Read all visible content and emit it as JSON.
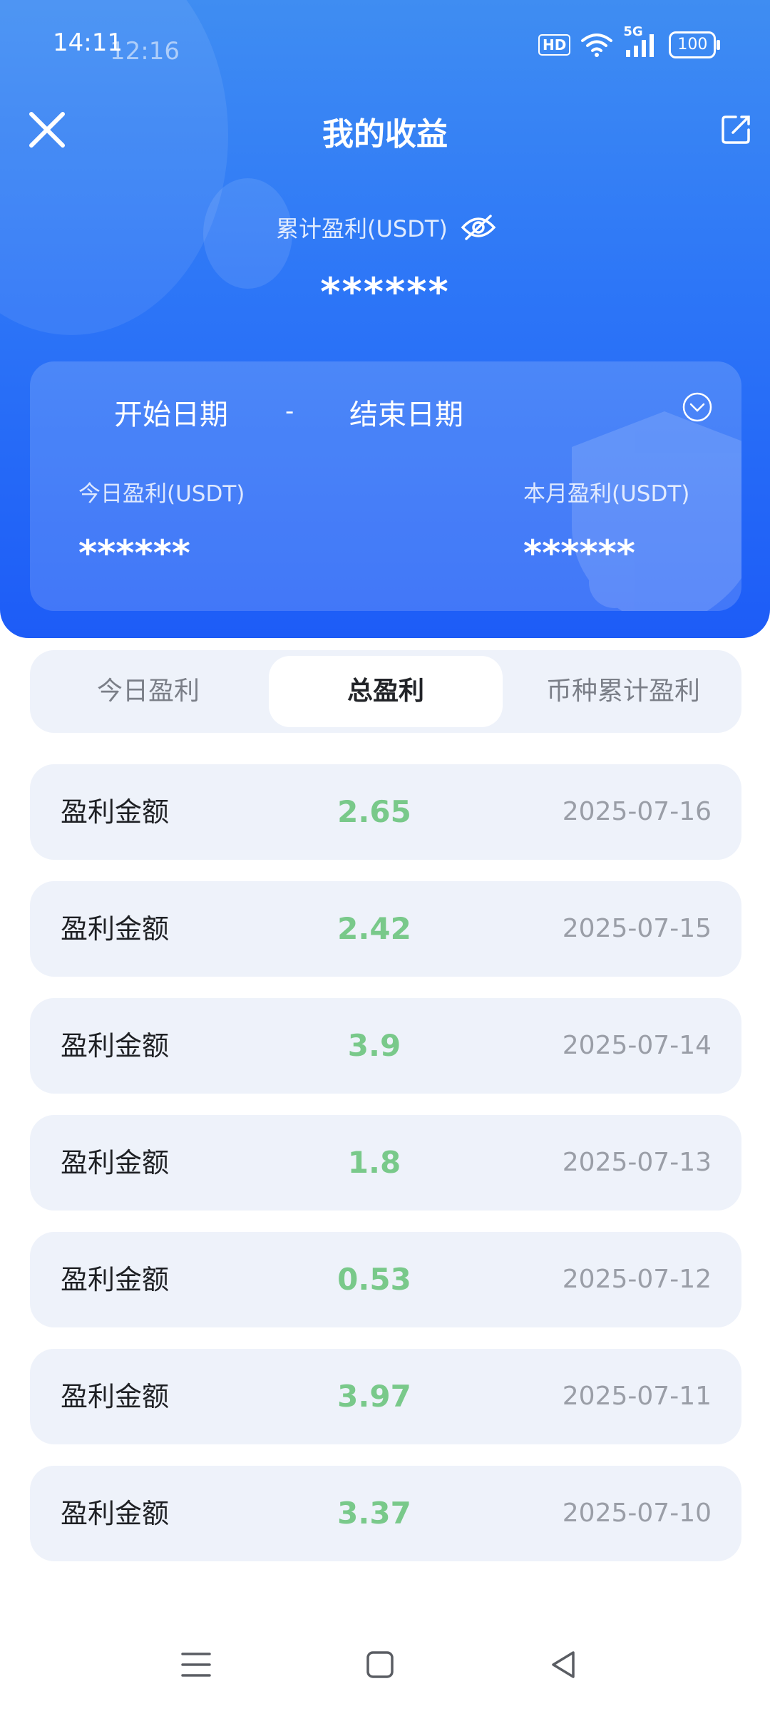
{
  "status_bar": {
    "time_primary": "14:11",
    "time_overlay": "12:16",
    "hd_badge": "HD",
    "network": "5G",
    "battery": "100"
  },
  "header": {
    "title": "我的收益",
    "close_icon": "close-x-icon",
    "share_icon": "share-export-icon",
    "cumulative_label": "累计盈利(USDT)",
    "cumulative_value": "******",
    "eye_icon": "eye-hidden-icon",
    "background_gradient": [
      "#3f8df2",
      "#1d5cf7"
    ]
  },
  "date_card": {
    "start_label": "开始日期",
    "separator": "-",
    "end_label": "结束日期",
    "dropdown_icon": "chevron-down-circle-icon",
    "today_label": "今日盈利(USDT)",
    "today_value": "******",
    "month_label": "本月盈利(USDT)",
    "month_value": "******"
  },
  "tabs": [
    {
      "label": "今日盈利",
      "active": false
    },
    {
      "label": "总盈利",
      "active": true
    },
    {
      "label": "币种累计盈利",
      "active": false
    }
  ],
  "records": [
    {
      "label": "盈利金额",
      "amount": "2.65",
      "date": "2025-07-16"
    },
    {
      "label": "盈利金额",
      "amount": "2.42",
      "date": "2025-07-15"
    },
    {
      "label": "盈利金额",
      "amount": "3.9",
      "date": "2025-07-14"
    },
    {
      "label": "盈利金额",
      "amount": "1.8",
      "date": "2025-07-13"
    },
    {
      "label": "盈利金额",
      "amount": "0.53",
      "date": "2025-07-12"
    },
    {
      "label": "盈利金额",
      "amount": "3.97",
      "date": "2025-07-11"
    },
    {
      "label": "盈利金额",
      "amount": "3.37",
      "date": "2025-07-10"
    }
  ],
  "colors": {
    "profit_green": "#79c98a",
    "row_background": "#eef2fa"
  },
  "nav_bar": {
    "menu_icon": "menu-icon",
    "home_icon": "home-square-icon",
    "back_icon": "back-triangle-icon"
  }
}
